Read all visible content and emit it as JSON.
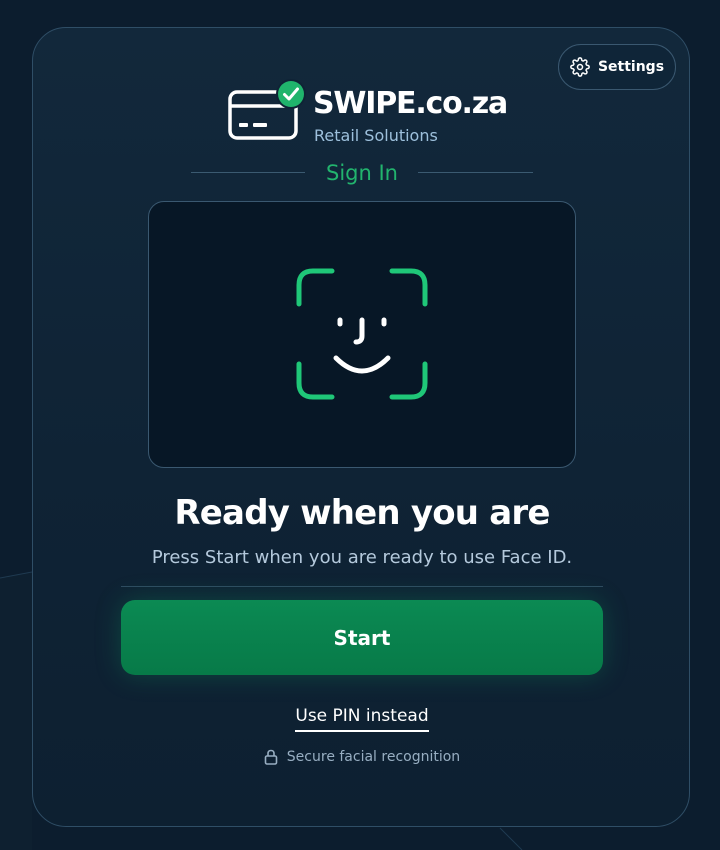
{
  "theme": {
    "background": "#0c1d2e",
    "card": "#12283b",
    "accent_green": "#22b46e",
    "button_green": "#0b8a53",
    "muted_text": "#b4c9dc"
  },
  "header": {
    "settings_label": "Settings",
    "settings_icon": "gear-icon"
  },
  "brand": {
    "logo_icon": "credit-card-check-icon",
    "name": "SWIPE.co.za",
    "tagline": "Retail Solutions"
  },
  "section": {
    "title": "Sign In"
  },
  "camera": {
    "icon": "face-id-icon"
  },
  "status": {
    "headline": "Ready when you are",
    "description": "Press Start when you are ready to use Face ID."
  },
  "actions": {
    "start_label": "Start",
    "pin_label": "Use PIN instead"
  },
  "footer": {
    "lock_icon": "lock-icon",
    "secure_label": "Secure facial recognition"
  }
}
